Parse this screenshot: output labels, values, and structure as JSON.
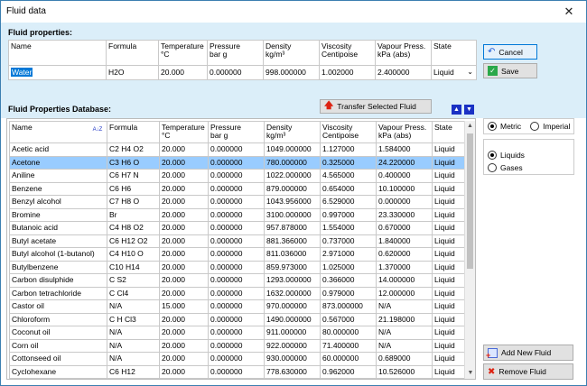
{
  "window": {
    "title": "Fluid data"
  },
  "fluid_properties": {
    "section_title": "Fluid properties:",
    "headers": [
      "Name",
      "Formula",
      "Temperature\n°C",
      "Pressure\nbar g",
      "Density\nkg/m³",
      "Viscosity\nCentipoise",
      "Vapour Press.\nkPa (abs)",
      "State"
    ],
    "row": {
      "name": "Water",
      "formula": "H2O",
      "temperature": "20.000",
      "pressure": "0.000000",
      "density": "998.000000",
      "viscosity": "1.002000",
      "vapour": "2.400000",
      "state": "Liquid"
    }
  },
  "buttons": {
    "cancel": "Cancel",
    "save": "Save",
    "transfer": "Transfer Selected Fluid",
    "add_new": "Add New Fluid",
    "remove": "Remove Fluid"
  },
  "database": {
    "section_title": "Fluid Properties Database:",
    "headers": [
      "Name",
      "Formula",
      "Temperature\n°C",
      "Pressure\nbar g",
      "Density\nkg/m³",
      "Viscosity\nCentipoise",
      "Vapour Press.\nkPa (abs)",
      "State"
    ],
    "sort_icon_text": "A↓Z",
    "rows": [
      [
        "Acetic acid",
        "C2 H4 O2",
        "20.000",
        "0.000000",
        "1049.000000",
        "1.127000",
        "1.584000",
        "Liquid"
      ],
      [
        "Acetone",
        "C3 H6 O",
        "20.000",
        "0.000000",
        "780.000000",
        "0.325000",
        "24.220000",
        "Liquid"
      ],
      [
        "Aniline",
        "C6 H7 N",
        "20.000",
        "0.000000",
        "1022.000000",
        "4.565000",
        "0.400000",
        "Liquid"
      ],
      [
        "Benzene",
        "C6 H6",
        "20.000",
        "0.000000",
        "879.000000",
        "0.654000",
        "10.100000",
        "Liquid"
      ],
      [
        "Benzyl alcohol",
        "C7 H8 O",
        "20.000",
        "0.000000",
        "1043.956000",
        "6.529000",
        "0.000000",
        "Liquid"
      ],
      [
        "Bromine",
        "Br",
        "20.000",
        "0.000000",
        "3100.000000",
        "0.997000",
        "23.330000",
        "Liquid"
      ],
      [
        "Butanoic acid",
        "C4 H8 O2",
        "20.000",
        "0.000000",
        "957.878000",
        "1.554000",
        "0.670000",
        "Liquid"
      ],
      [
        "Butyl acetate",
        "C6 H12 O2",
        "20.000",
        "0.000000",
        "881.366000",
        "0.737000",
        "1.840000",
        "Liquid"
      ],
      [
        "Butyl alcohol (1-butanol)",
        "C4 H10 O",
        "20.000",
        "0.000000",
        "811.036000",
        "2.971000",
        "0.620000",
        "Liquid"
      ],
      [
        "Butylbenzene",
        "C10 H14",
        "20.000",
        "0.000000",
        "859.973000",
        "1.025000",
        "1.370000",
        "Liquid"
      ],
      [
        "Carbon disulphide",
        "C S2",
        "20.000",
        "0.000000",
        "1293.000000",
        "0.366000",
        "14.000000",
        "Liquid"
      ],
      [
        "Carbon tetrachloride",
        "C Cl4",
        "20.000",
        "0.000000",
        "1632.000000",
        "0.979000",
        "12.000000",
        "Liquid"
      ],
      [
        "Castor oil",
        "N/A",
        "15.000",
        "0.000000",
        "970.000000",
        "873.000000",
        "N/A",
        "Liquid"
      ],
      [
        "Chloroform",
        "C H Cl3",
        "20.000",
        "0.000000",
        "1490.000000",
        "0.567000",
        "21.198000",
        "Liquid"
      ],
      [
        "Coconut oil",
        "N/A",
        "20.000",
        "0.000000",
        "911.000000",
        "80.000000",
        "N/A",
        "Liquid"
      ],
      [
        "Corn oil",
        "N/A",
        "20.000",
        "0.000000",
        "922.000000",
        "71.400000",
        "N/A",
        "Liquid"
      ],
      [
        "Cottonseed oil",
        "N/A",
        "20.000",
        "0.000000",
        "930.000000",
        "60.000000",
        "0.689000",
        "Liquid"
      ],
      [
        "Cyclohexane",
        "C6 H12",
        "20.000",
        "0.000000",
        "778.630000",
        "0.962000",
        "10.526000",
        "Liquid"
      ]
    ],
    "selected_index": 1
  },
  "units": {
    "metric": "Metric",
    "imperial": "Imperial",
    "selected": "Metric"
  },
  "phase": {
    "liquids": "Liquids",
    "gases": "Gases",
    "selected": "Liquids"
  },
  "colors": {
    "panel": "#dbeef9",
    "selection": "#99ccff",
    "accent": "#0078d7"
  }
}
